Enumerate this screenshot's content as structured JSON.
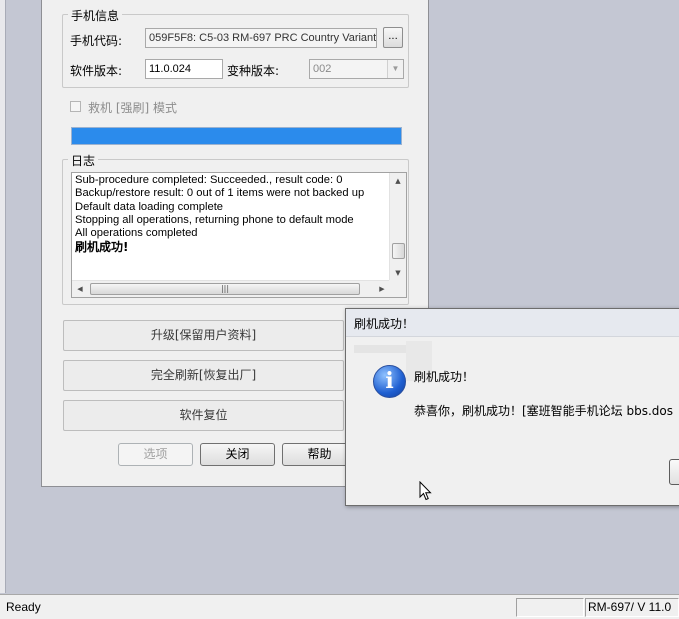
{
  "phone_info": {
    "legend": "手机信息",
    "code_label": "手机代码:",
    "code_value": "059F5F8: C5-03 RM-697 PRC Country Variant",
    "browse_label": "...",
    "sw_version_label": "软件版本:",
    "sw_version_value": "11.0.024",
    "variant_label": "变种版本:",
    "variant_value": "002"
  },
  "rescue_mode": {
    "label": "救机 [强刷] 模式",
    "checked": false,
    "enabled": false
  },
  "progress": {
    "percent": 100,
    "color": "#2b8bec"
  },
  "log": {
    "legend": "日志",
    "lines": [
      "Sub-procedure completed: Succeeded., result code: 0",
      "Backup/restore result: 0 out of 1 items were not backed up",
      "Default data loading complete",
      "Stopping all operations, returning phone to default mode",
      "All operations completed",
      "刷机成功!"
    ]
  },
  "actions": {
    "upgrade_keep_data": "升级[保留用户资料]",
    "full_refresh": "完全刷新[恢复出厂]",
    "software_reset": "软件复位"
  },
  "footer_buttons": {
    "options": "选项",
    "close": "关闭",
    "help": "帮助"
  },
  "success_dialog": {
    "title": "刷机成功！",
    "heading": "刷机成功！",
    "message": "恭喜你，刷机成功！[塞班智能手机论坛 bbs.dos",
    "icon": "info-icon",
    "accent": "#1f5fd1"
  },
  "statusbar": {
    "ready": "Ready",
    "right_text": "RM-697/ V 11.0"
  }
}
